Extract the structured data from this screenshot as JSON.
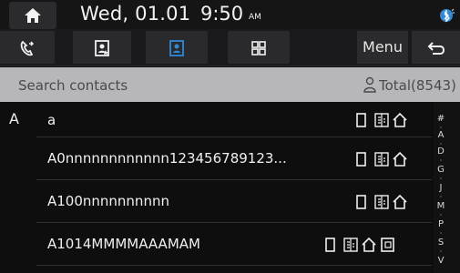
{
  "status": {
    "date": "Wed, 01.01",
    "time": "9:50",
    "ampm": "AM"
  },
  "tabs": {
    "menu_label": "Menu"
  },
  "search": {
    "placeholder": "Search contacts",
    "total": "Total(8543)"
  },
  "section": "A",
  "contacts": [
    {
      "name": "a"
    },
    {
      "name": "A0nnnnnnnnnnnn123456789123..."
    },
    {
      "name": "A100nnnnnnnnnn"
    },
    {
      "name": "A1014MMMMAAAMAM"
    }
  ],
  "index_letters": [
    "#",
    "A",
    "D",
    "G",
    "J",
    "M",
    "P",
    "S",
    "V"
  ],
  "colors": {
    "background": "#0e0e0f",
    "search_bar": "#b7b7ba",
    "active_tab_icon": "#2f8ad8",
    "bluetooth": "#2f8ad8"
  }
}
